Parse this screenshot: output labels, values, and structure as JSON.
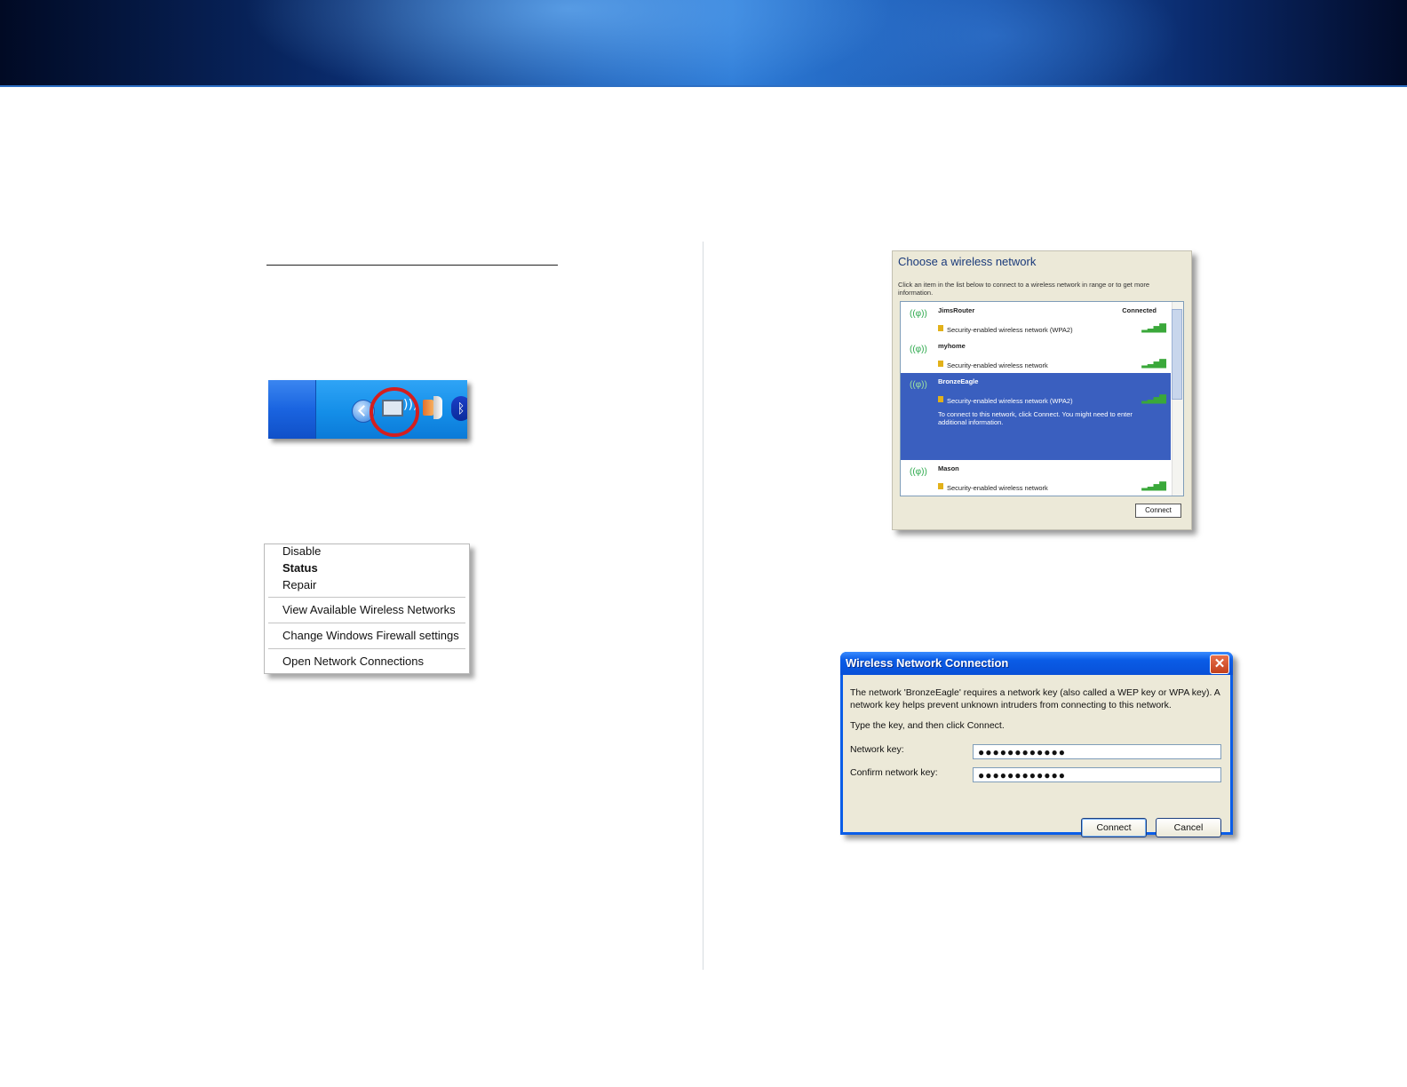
{
  "context_menu": {
    "disable": "Disable",
    "status": "Status",
    "repair": "Repair",
    "view_networks": "View Available Wireless Networks",
    "firewall": "Change Windows Firewall settings",
    "open_connections": "Open Network Connections"
  },
  "choose_network": {
    "title": "Choose a wireless network",
    "instructions": "Click an item in the list below to connect to a wireless network in range or to get more information.",
    "networks": [
      {
        "name": "JimsRouter",
        "status": "Connected",
        "security": "Security-enabled wireless network (WPA2)"
      },
      {
        "name": "myhome",
        "status": "",
        "security": "Security-enabled wireless network"
      },
      {
        "name": "BronzeEagle",
        "status": "",
        "security": "Security-enabled wireless network (WPA2)",
        "note": "To connect to this network, click Connect. You might need to enter additional information."
      },
      {
        "name": "Mason",
        "status": "",
        "security": "Security-enabled wireless network"
      }
    ],
    "connect_label": "Connect"
  },
  "dialog": {
    "title": "Wireless Network Connection",
    "message": "The network 'BronzeEagle' requires a network key (also called a WEP key or WPA key). A network key helps prevent unknown intruders from connecting to this network.",
    "instruction": "Type the key, and then click Connect.",
    "network_key_label": "Network key:",
    "confirm_key_label": "Confirm network key:",
    "network_key_value": "●●●●●●●●●●●●",
    "confirm_key_value": "●●●●●●●●●●●●",
    "connect_label": "Connect",
    "cancel_label": "Cancel"
  },
  "colors": {
    "banner": "#1c5fb8",
    "selection": "#3a5fbf",
    "xp_title": "#0a5ce6",
    "highlight_ring": "#d41e1e"
  }
}
